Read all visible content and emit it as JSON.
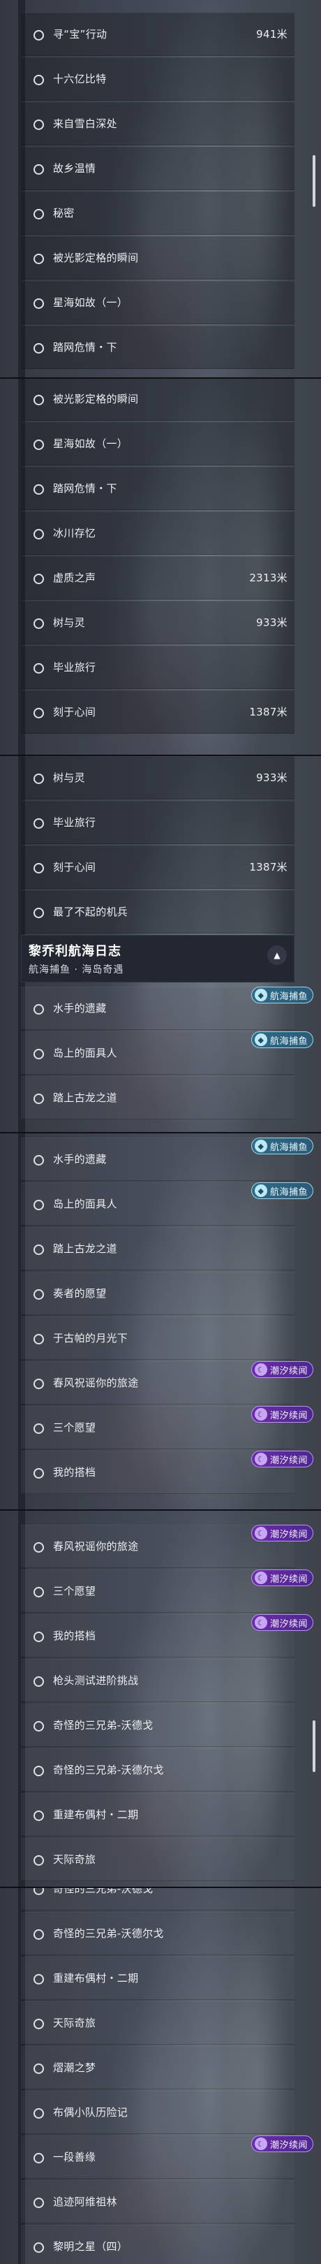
{
  "header": {
    "title": "黎乔利航海日志",
    "subtitle": "航海捕鱼 · 海岛奇遇",
    "collapse_icon": "chevron-up-icon"
  },
  "badges": {
    "tide": "潮汐续闻",
    "fish": "航海捕鱼"
  },
  "colors": {
    "tide_badge": "#6b2ca8",
    "fish_badge": "#2f6b86",
    "list_bg": "#3a3f47"
  },
  "panel1": [
    {
      "label": "寻“宝”行动",
      "distance": "941米"
    },
    {
      "label": "十六亿比特"
    },
    {
      "label": "来自雪白深处"
    },
    {
      "label": "故乡温情"
    },
    {
      "label": "秘密"
    },
    {
      "label": "被光影定格的瞬间"
    },
    {
      "label": "星海如故（一）"
    },
    {
      "label": "踏网危情・下"
    }
  ],
  "panel2": [
    {
      "label": "被光影定格的瞬间"
    },
    {
      "label": "星海如故（一）"
    },
    {
      "label": "踏网危情・下"
    },
    {
      "label": "冰川存忆"
    },
    {
      "label": "虚质之声",
      "distance": "2313米"
    },
    {
      "label": "树与灵",
      "distance": "933米"
    },
    {
      "label": "毕业旅行"
    },
    {
      "label": "刻于心间",
      "distance": "1387米"
    }
  ],
  "panel3": [
    {
      "label": "树与灵",
      "distance": "933米"
    },
    {
      "label": "毕业旅行"
    },
    {
      "label": "刻于心间",
      "distance": "1387米"
    },
    {
      "label": "最了不起的机兵"
    },
    {
      "label": "水手的遗藏"
    },
    {
      "label": "岛上的面具人"
    },
    {
      "label": "踏上古龙之道"
    }
  ],
  "panel4": [
    {
      "label": "水手的遗藏"
    },
    {
      "label": "岛上的面具人"
    },
    {
      "label": "踏上古龙之道"
    },
    {
      "label": "奏者的愿望"
    },
    {
      "label": "于古帕的月光下"
    },
    {
      "label": "春风祝谣你的旅途"
    },
    {
      "label": "三个愿望"
    },
    {
      "label": "我的搭档"
    }
  ],
  "panel5": [
    {
      "label": "春风祝谣你的旅途"
    },
    {
      "label": "三个愿望"
    },
    {
      "label": "我的搭档"
    },
    {
      "label": "枪头测试进阶挑战"
    },
    {
      "label": "奇怪的三兄弟-沃德戈"
    },
    {
      "label": "奇怪的三兄弟-沃德尔戈"
    },
    {
      "label": "重建布偶村・二期"
    },
    {
      "label": "天际奇旅"
    }
  ],
  "panel6": [
    {
      "label": "奇怪的三兄弟-沃德戈"
    },
    {
      "label": "奇怪的三兄弟-沃德尔戈"
    },
    {
      "label": "重建布偶村・二期"
    },
    {
      "label": "天际奇旅"
    },
    {
      "label": "熠潮之梦"
    },
    {
      "label": "布偶小队历险记"
    },
    {
      "label": "一段善缘"
    },
    {
      "label": "追迹阿维祖林"
    },
    {
      "label": "黎明之星（四）"
    }
  ]
}
